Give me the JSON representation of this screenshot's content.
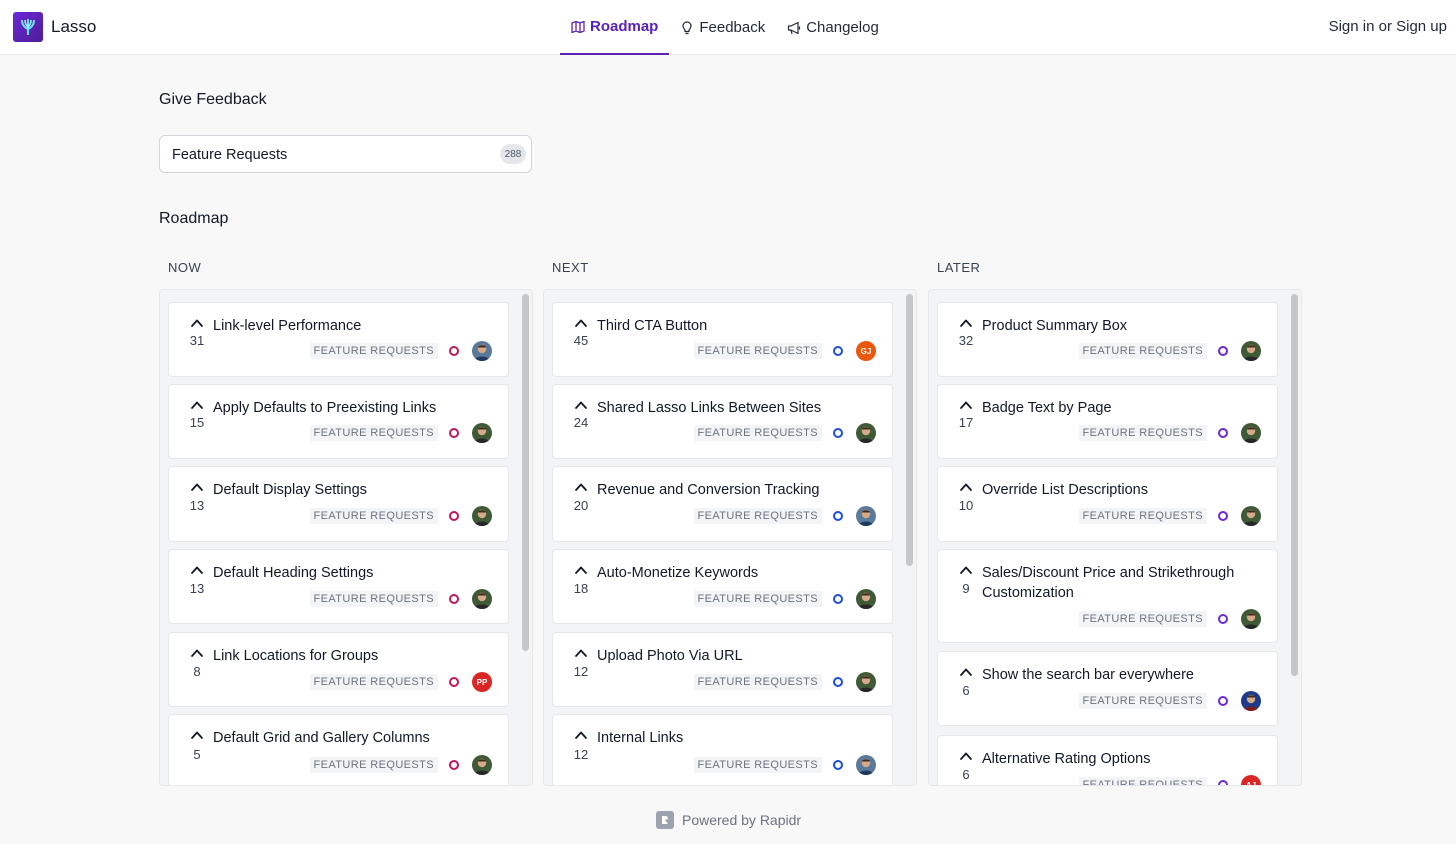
{
  "app": {
    "name": "Lasso"
  },
  "nav": {
    "roadmap": "Roadmap",
    "feedback": "Feedback",
    "changelog": "Changelog"
  },
  "auth": {
    "text": "Sign in or Sign up"
  },
  "give_feedback": {
    "heading": "Give Feedback",
    "board_label": "Feature Requests",
    "board_count": "288"
  },
  "roadmap": {
    "heading": "Roadmap",
    "columns": [
      {
        "title": "NOW",
        "status_color": "#be185d",
        "cards": [
          {
            "title": "Link-level Performance",
            "votes": "31",
            "tag": "FEATURE REQUESTS",
            "avatar": "photo-blue"
          },
          {
            "title": "Apply Defaults to Preexisting Links",
            "votes": "15",
            "tag": "FEATURE REQUESTS",
            "avatar": "photo-green"
          },
          {
            "title": "Default Display Settings",
            "votes": "13",
            "tag": "FEATURE REQUESTS",
            "avatar": "photo-green"
          },
          {
            "title": "Default Heading Settings",
            "votes": "13",
            "tag": "FEATURE REQUESTS",
            "avatar": "photo-green"
          },
          {
            "title": "Link Locations for Groups",
            "votes": "8",
            "tag": "FEATURE REQUESTS",
            "avatar": "initials",
            "initials": "PP",
            "avatar_color": "#dc2626"
          },
          {
            "title": "Default Grid and Gallery Columns",
            "votes": "5",
            "tag": "FEATURE REQUESTS",
            "avatar": "photo-green"
          }
        ]
      },
      {
        "title": "NEXT",
        "status_color": "#1d4ed8",
        "cards": [
          {
            "title": "Third CTA Button",
            "votes": "45",
            "tag": "FEATURE REQUESTS",
            "avatar": "initials",
            "initials": "GJ",
            "avatar_color": "#ea580c"
          },
          {
            "title": "Shared Lasso Links Between Sites",
            "votes": "24",
            "tag": "FEATURE REQUESTS",
            "avatar": "photo-green"
          },
          {
            "title": "Revenue and Conversion Tracking",
            "votes": "20",
            "tag": "FEATURE REQUESTS",
            "avatar": "photo-blue"
          },
          {
            "title": "Auto-Monetize Keywords",
            "votes": "18",
            "tag": "FEATURE REQUESTS",
            "avatar": "photo-green"
          },
          {
            "title": "Upload Photo Via URL",
            "votes": "12",
            "tag": "FEATURE REQUESTS",
            "avatar": "photo-green"
          },
          {
            "title": "Internal Links",
            "votes": "12",
            "tag": "FEATURE REQUESTS",
            "avatar": "photo-blue"
          }
        ]
      },
      {
        "title": "LATER",
        "status_color": "#6d28d9",
        "cards": [
          {
            "title": "Product Summary Box",
            "votes": "32",
            "tag": "FEATURE REQUESTS",
            "avatar": "photo-green"
          },
          {
            "title": "Badge Text by Page",
            "votes": "17",
            "tag": "FEATURE REQUESTS",
            "avatar": "photo-green"
          },
          {
            "title": "Override List Descriptions",
            "votes": "10",
            "tag": "FEATURE REQUESTS",
            "avatar": "photo-green"
          },
          {
            "title": "Sales/Discount Price and Strikethrough Customization",
            "votes": "9",
            "tag": "FEATURE REQUESTS",
            "avatar": "photo-green"
          },
          {
            "title": "Show the search bar everywhere",
            "votes": "6",
            "tag": "FEATURE REQUESTS",
            "avatar": "photo-navy"
          },
          {
            "title": "Alternative Rating Options",
            "votes": "6",
            "tag": "FEATURE REQUESTS",
            "avatar": "initials",
            "initials": "AJ",
            "avatar_color": "#dc2626"
          }
        ]
      }
    ]
  },
  "footer": {
    "text": "Powered by Rapidr"
  },
  "colors": {
    "accent": "#5b21b6",
    "now": "#be185d",
    "next": "#1d4ed8",
    "later": "#6d28d9"
  }
}
